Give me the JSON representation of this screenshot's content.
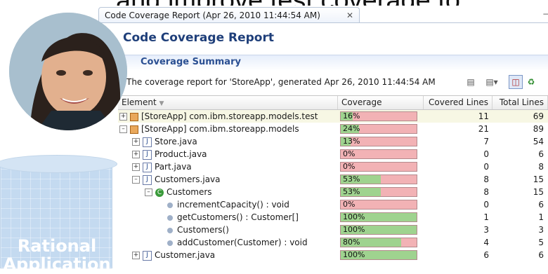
{
  "banner": {
    "text": "and improve test coverage to"
  },
  "window": {
    "tab_title": "Code Coverage Report (Apr 26, 2010 11:44:54 AM)",
    "tab_close": "✕",
    "minimize": "–",
    "form_title": "Code Coverage Report",
    "section_title": "Coverage Summary",
    "summary_text": "The coverage report for 'StoreApp', generated Apr 26, 2010 11:44:54 AM"
  },
  "table": {
    "headers": {
      "element": "Element",
      "coverage": "Coverage",
      "covered_lines": "Covered Lines",
      "total_lines": "Total Lines"
    },
    "rows": [
      {
        "label": "[StoreApp] com.ibm.storeapp.models.test",
        "coverage": "16%",
        "covered": "11",
        "total": "69"
      },
      {
        "label": "[StoreApp] com.ibm.storeapp.models",
        "coverage": "24%",
        "covered": "21",
        "total": "89"
      },
      {
        "label": "Store.java",
        "coverage": "13%",
        "covered": "7",
        "total": "54"
      },
      {
        "label": "Product.java",
        "coverage": "0%",
        "covered": "0",
        "total": "6"
      },
      {
        "label": "Part.java",
        "coverage": "0%",
        "covered": "0",
        "total": "8"
      },
      {
        "label": "Customers.java",
        "coverage": "53%",
        "covered": "8",
        "total": "15"
      },
      {
        "label": "Customers",
        "coverage": "53%",
        "covered": "8",
        "total": "15"
      },
      {
        "label": "incrementCapacity() : void",
        "coverage": "0%",
        "covered": "0",
        "total": "6"
      },
      {
        "label": "getCustomers() : Customer[]",
        "coverage": "100%",
        "covered": "1",
        "total": "1"
      },
      {
        "label": "Customers()",
        "coverage": "100%",
        "covered": "3",
        "total": "3"
      },
      {
        "label": "addCustomer(Customer) : void",
        "coverage": "80%",
        "covered": "4",
        "total": "5"
      },
      {
        "label": "Customer.java",
        "coverage": "100%",
        "covered": "6",
        "total": "6"
      }
    ],
    "coverage_fraction": [
      0.16,
      0.24,
      0.13,
      0.0,
      0.0,
      0.53,
      0.53,
      0.0,
      1.0,
      1.0,
      0.8,
      1.0
    ]
  },
  "overlay": {
    "rational_line1": "Rational",
    "rational_line2": "Application"
  },
  "colors": {
    "covered": "#9fd38f",
    "uncovered": "#f2b2b5",
    "title": "#1f3f7a"
  }
}
